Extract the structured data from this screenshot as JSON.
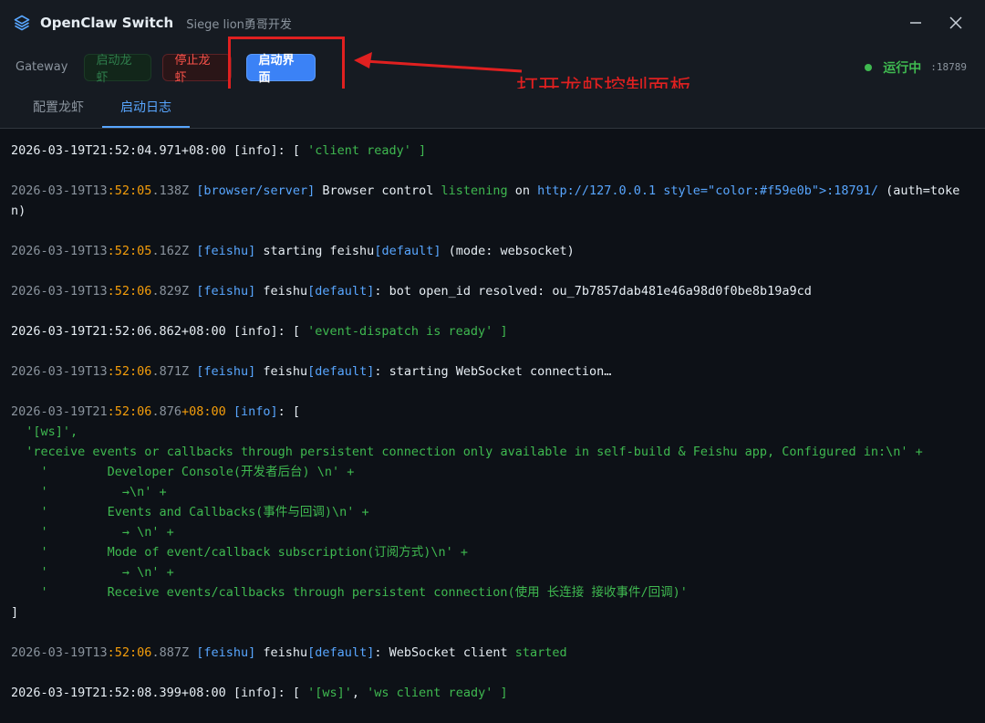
{
  "app": {
    "title": "OpenClaw Switch",
    "subtitle": "Siege lion勇哥开发"
  },
  "window_controls": {
    "minimize_icon": "minimize-icon",
    "close_icon": "close-icon"
  },
  "toolbar": {
    "gateway_label": "Gateway",
    "start_label": "启动龙虾",
    "stop_label": "停止龙虾",
    "open_ui_label": "启动界面",
    "status_text": "运行中",
    "status_port": ":18789"
  },
  "annotation": {
    "text": "打开龙虾控制面板",
    "color": "#e02020"
  },
  "tabs": [
    {
      "label": "配置龙虾",
      "active": false
    },
    {
      "label": "启动日志",
      "active": true
    }
  ],
  "colors": {
    "accent": "#3b82f6",
    "running": "#3fb950",
    "stop": "#f85149",
    "timestamp_highlight": "#f59e0b",
    "tag": "#58a6ff"
  },
  "log": {
    "l1": {
      "text": "2026-03-19T21:52:04.971+08:00 [info]: [ ",
      "str": "'client ready'",
      "end": " ]"
    },
    "l2": {
      "ts_pre": "2026-03-19T13",
      "ts_hl": ":52:05",
      "ts_post": ".138Z",
      "tag": "[browser/server]",
      "msg1": " Browser control ",
      "listening": "listening",
      "msg2": " on ",
      "url": "http://127.0.0.1 style=\"color:#f59e0b\">:18791/",
      "msg3": " (auth=token)"
    },
    "l3": {
      "ts_pre": "2026-03-19T13",
      "ts_hl": ":52:05",
      "ts_post": ".162Z",
      "tag": "[feishu]",
      "msg1": " starting feishu",
      "tag2": "[default]",
      "msg2": " (mode: websocket)"
    },
    "l4": {
      "ts_pre": "2026-03-19T13",
      "ts_hl": ":52:06",
      "ts_post": ".829Z",
      "tag": "[feishu]",
      "msg1": " feishu",
      "tag2": "[default]",
      "msg2": ": bot open_id resolved: ou_7b7857dab481e46a98d0f0be8b19a9cd"
    },
    "l5": {
      "text": "2026-03-19T21:52:06.862+08:00 [info]: [ ",
      "str": "'event-dispatch is ready'",
      "end": " ]"
    },
    "l6": {
      "ts_pre": "2026-03-19T13",
      "ts_hl": ":52:06",
      "ts_post": ".871Z",
      "tag": "[feishu]",
      "msg1": " feishu",
      "tag2": "[default]",
      "msg2": ": starting WebSocket connection…"
    },
    "l7": {
      "ts_pre": "2026-03-19T21",
      "ts_hl": ":52:06",
      "ts_mid": ".876",
      "ts_tz": "+08:00",
      "tag": "[info]",
      "open": ": [",
      "lines": [
        "  '[ws]',",
        "  'receive events or callbacks through persistent connection only available in self-build & Feishu app, Configured in:\\n' +",
        "    '        Developer Console(开发者后台) \\n' +",
        "    '          →\\n' +",
        "    '        Events and Callbacks(事件与回调)\\n' +",
        "    '          → \\n' +",
        "    '        Mode of event/callback subscription(订阅方式)\\n' +",
        "    '          → \\n' +",
        "    '        Receive events/callbacks through persistent connection(使用 长连接 接收事件/回调)'"
      ],
      "close": "]"
    },
    "l8": {
      "ts_pre": "2026-03-19T13",
      "ts_hl": ":52:06",
      "ts_post": ".887Z",
      "tag": "[feishu]",
      "msg1": " feishu",
      "tag2": "[default]",
      "msg2": ": WebSocket client ",
      "started": "started"
    },
    "l9": {
      "text": "2026-03-19T21:52:08.399+08:00 [info]: [ ",
      "str1": "'[ws]'",
      "mid": ", ",
      "str2": "'ws client ready'",
      "end": " ]"
    }
  }
}
